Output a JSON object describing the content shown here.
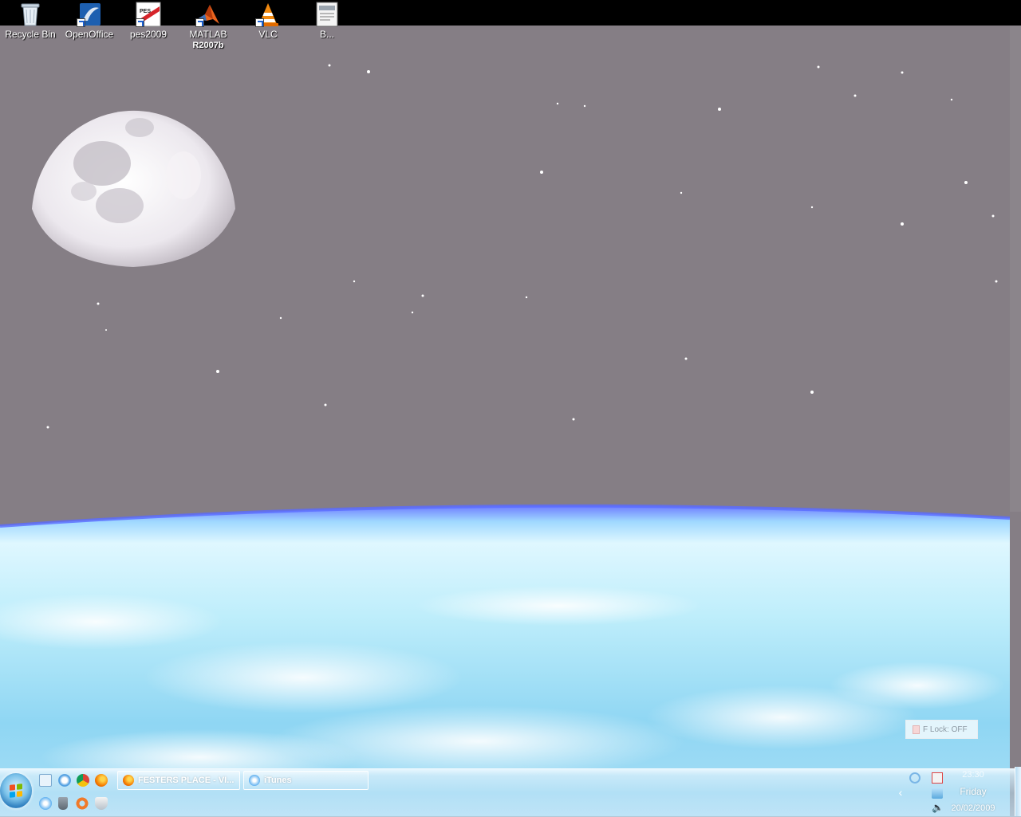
{
  "desktop_icons": [
    {
      "name": "recycle-bin",
      "label": "Recycle Bin",
      "label_line2": "",
      "icon": "recycle-bin-icon"
    },
    {
      "name": "openoffice",
      "label": "OpenOffice",
      "label_line2": "",
      "icon": "openoffice-icon"
    },
    {
      "name": "pes2009",
      "label": "pes2009",
      "label_line2": "",
      "icon": "pes2009-icon"
    },
    {
      "name": "matlab",
      "label": "MATLAB",
      "label_line2": "R2007b",
      "icon": "matlab-icon"
    },
    {
      "name": "vlc",
      "label": "VLC",
      "label_line2": "",
      "icon": "vlc-icon"
    },
    {
      "name": "b",
      "label": "B...",
      "label_line2": "",
      "icon": "document-icon"
    }
  ],
  "flock": {
    "label": "F Lock: OFF"
  },
  "taskbar": {
    "quick_launch": [
      "show-desktop-icon",
      "ie-icon",
      "chrome-icon",
      "firefox-icon",
      "itunes-icon",
      "bin-icon",
      "lifesaver-icon",
      "shield-icon"
    ],
    "buttons": [
      {
        "label": "FESTERS PLACE - VI...",
        "icon": "firefox-icon"
      },
      {
        "label": "iTunes",
        "icon": "itunes-icon"
      }
    ],
    "tray_icons": [
      "network-icon",
      "antivirus-icon",
      "display-icon",
      "volume-icon"
    ],
    "clock": {
      "time": "23:30",
      "day": "Friday",
      "date": "20/02/2009"
    }
  },
  "colors": {
    "sky": "#857e85",
    "earth": "#bfeaf7",
    "atmosphere": "#6e88ff"
  }
}
